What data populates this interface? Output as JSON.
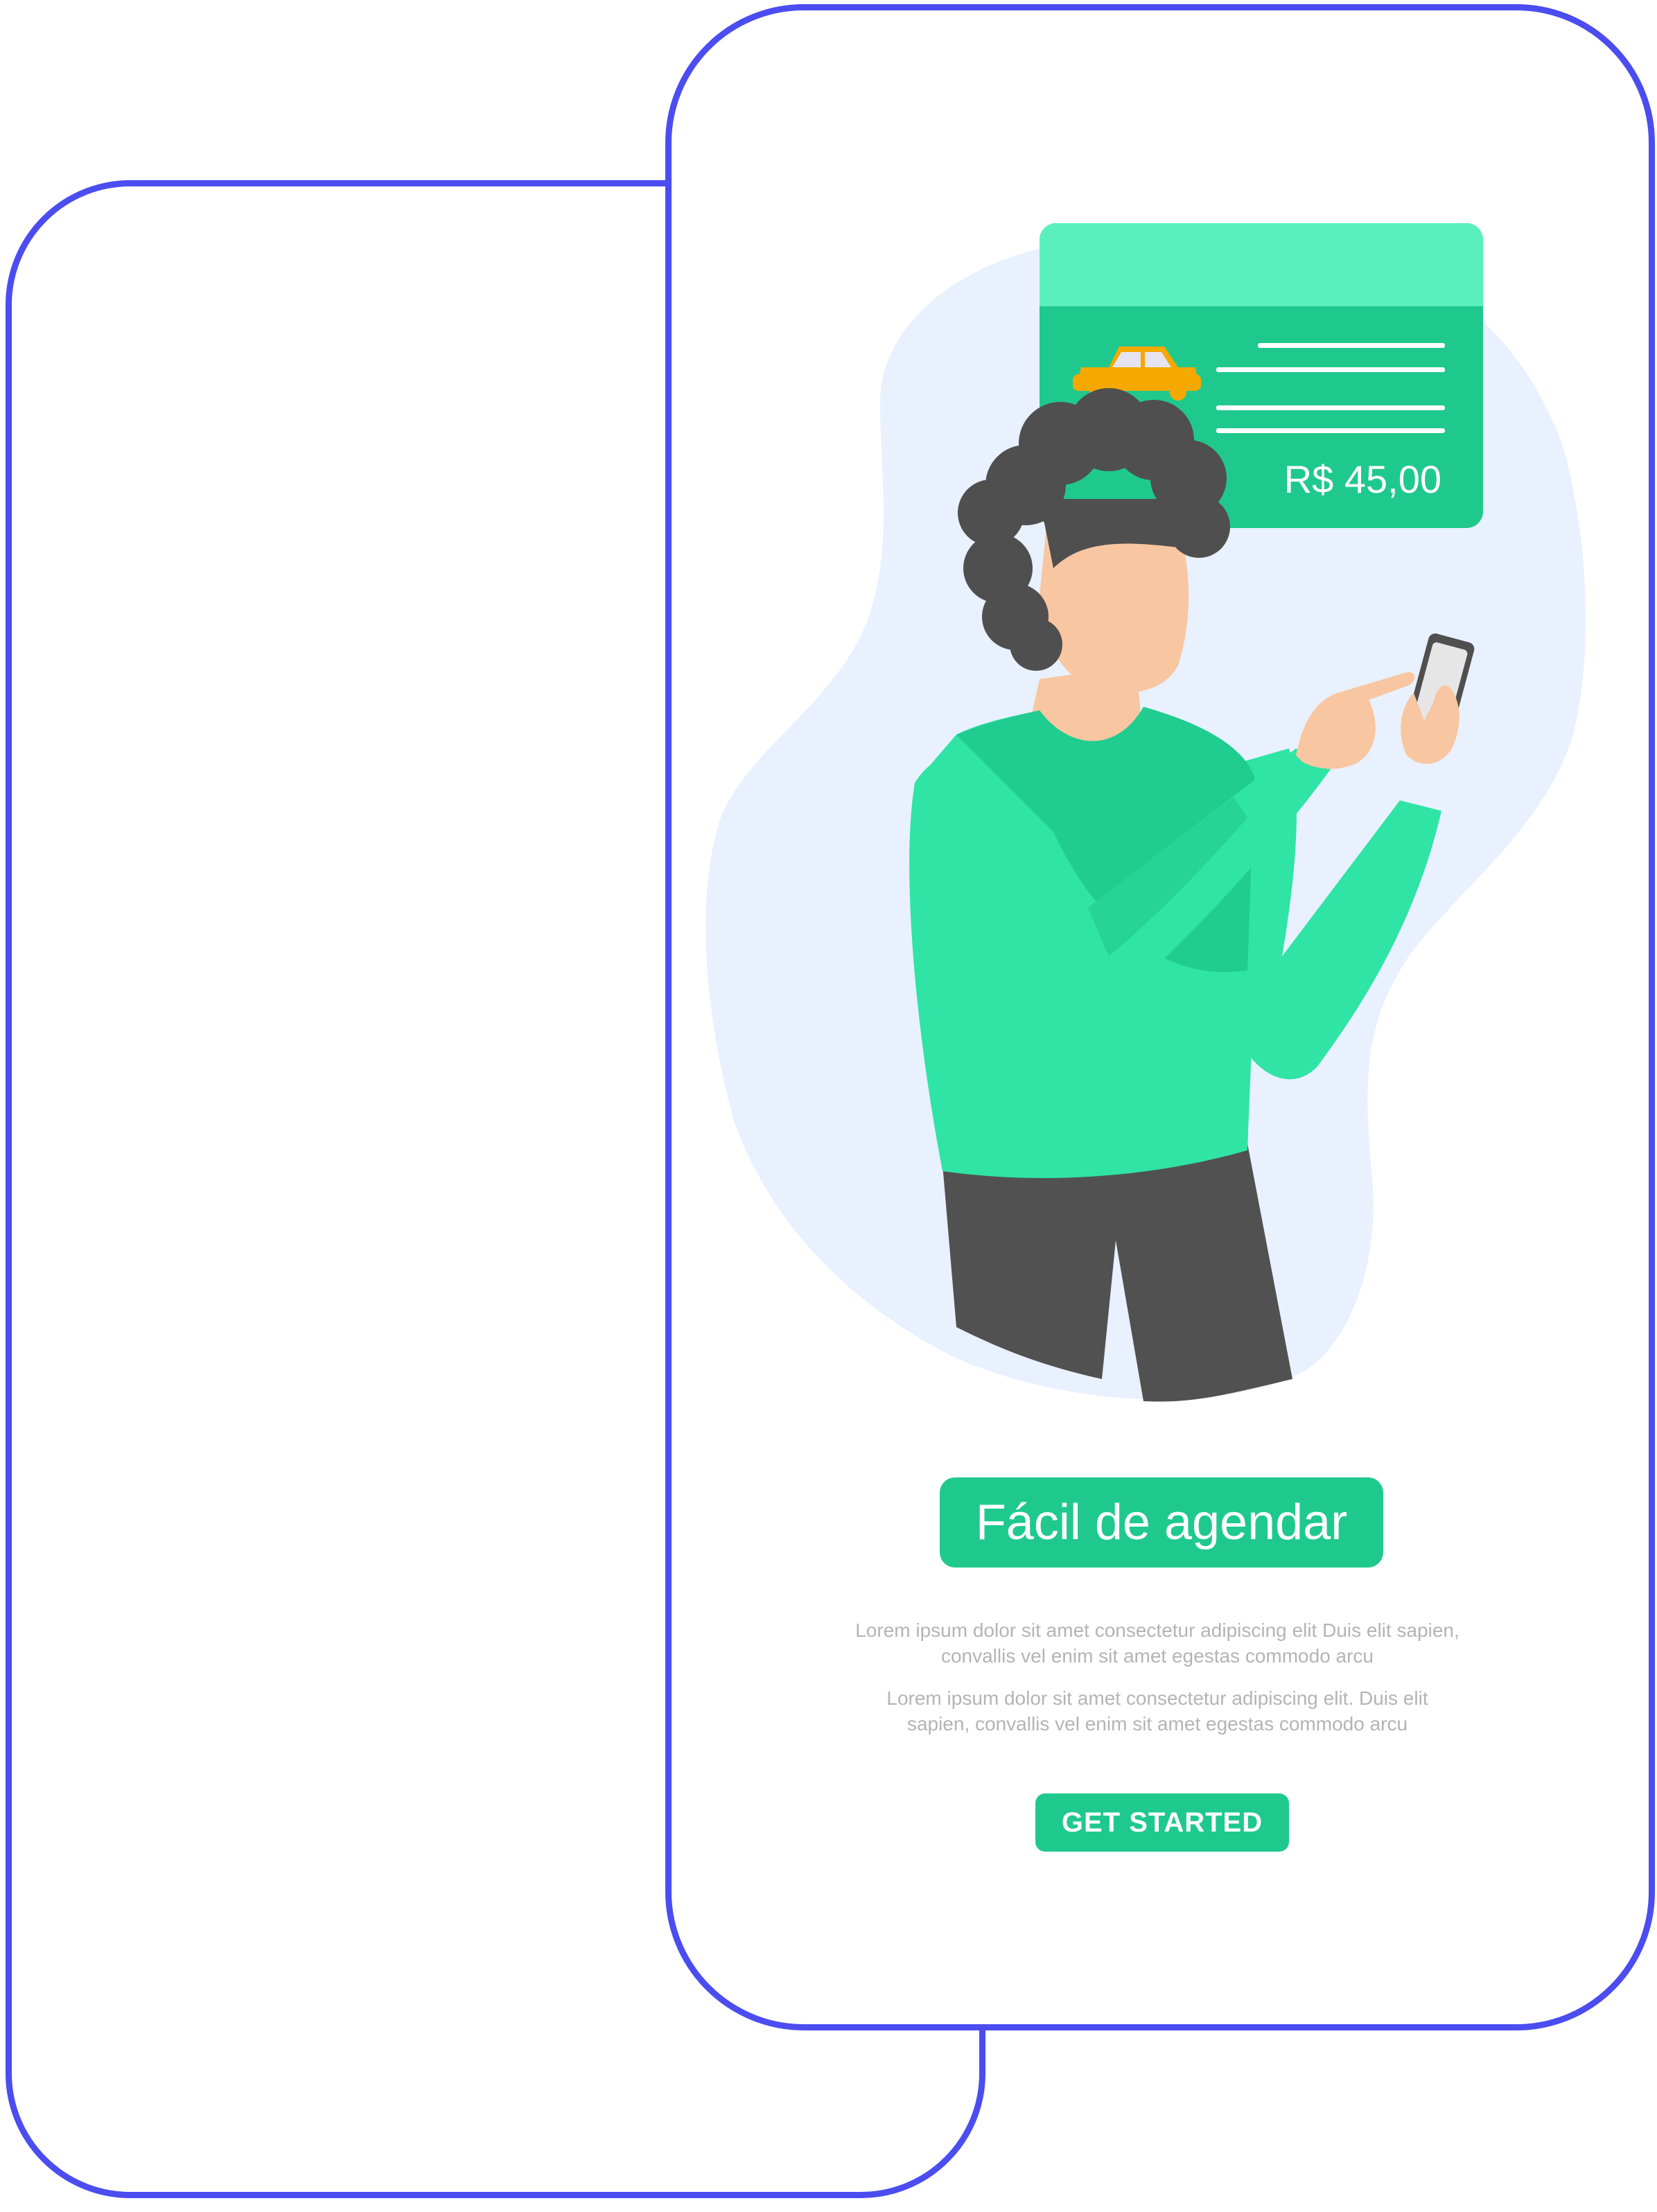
{
  "receipt": {
    "price": "R$ 45,00",
    "icon": "taxi-icon"
  },
  "onboarding": {
    "title": "Fácil de agendar",
    "description_1": "Lorem ipsum dolor sit amet consectetur adipiscing elit Duis elit sapien, convallis vel enim sit amet egestas commodo arcu",
    "description_2": "Lorem ipsum dolor sit amet consectetur adipiscing elit. Duis elit sapien, convallis vel enim sit amet egestas commodo arcu",
    "cta_label": "GET STARTED"
  },
  "colors": {
    "frame": "#4B4DF0",
    "accent": "#1FC98E",
    "card_header": "#5AF0BD",
    "blob": "#E8F1FD",
    "sweater": "#2FE4A4",
    "hair": "#4F4F4F",
    "skin": "#F8C6A0",
    "taxi": "#F5A800"
  }
}
